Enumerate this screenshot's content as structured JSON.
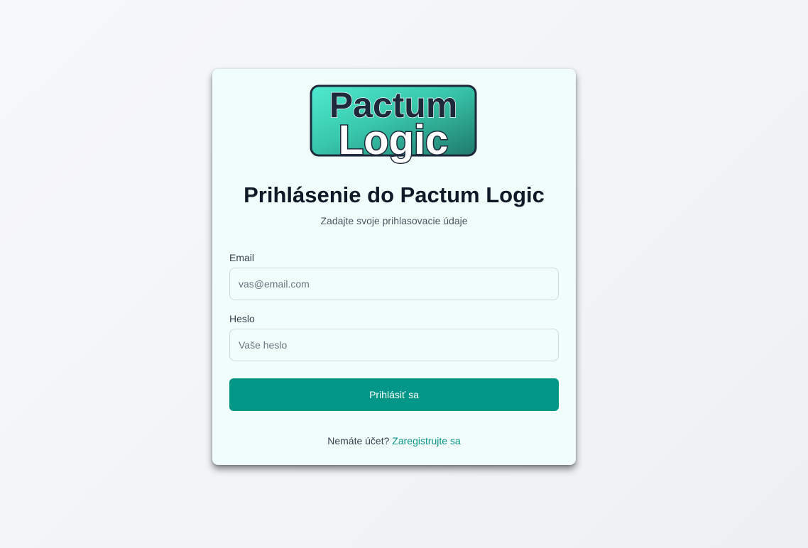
{
  "logo": {
    "line1": "Pactum",
    "line2": "Logic",
    "colors": {
      "gradient_start": "#4eead0",
      "gradient_end": "#1f7a6c",
      "outline": "#1e293b"
    }
  },
  "login": {
    "title": "Prihlásenie do Pactum Logic",
    "subtitle": "Zadajte svoje prihlasovacie údaje",
    "email_label": "Email",
    "email_placeholder": "vas@email.com",
    "password_label": "Heslo",
    "password_placeholder": "Vaše heslo",
    "submit_label": "Prihlásiť sa",
    "no_account_text": "Nemáte účet?",
    "register_link": "Zaregistrujte sa"
  },
  "colors": {
    "accent": "#009688",
    "link": "#0d9488",
    "card_bg": "#f0fdfa"
  }
}
